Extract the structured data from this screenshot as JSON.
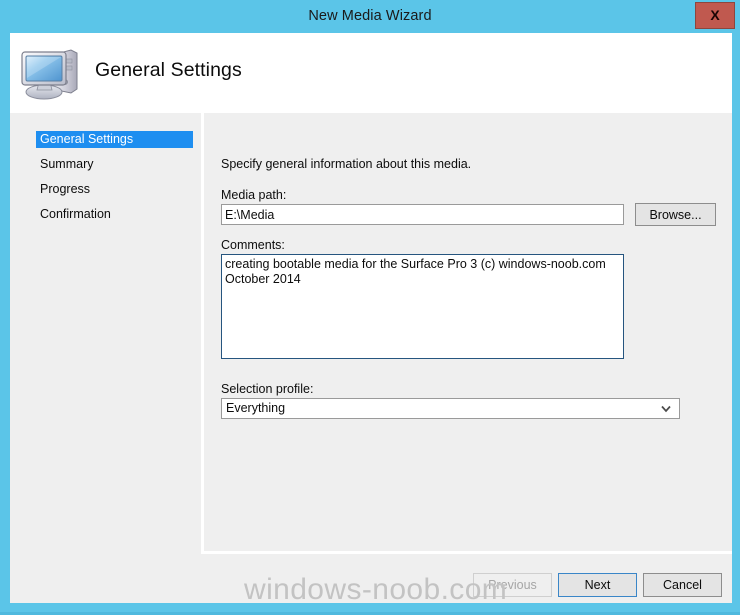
{
  "window": {
    "title": "New Media Wizard",
    "close_label": "X",
    "accent_color": "#5bc5e8",
    "close_color": "#c0594f"
  },
  "header": {
    "title": "General Settings",
    "icon": "computer-icon"
  },
  "sidebar": {
    "items": [
      {
        "label": "General Settings",
        "selected": true
      },
      {
        "label": "Summary",
        "selected": false
      },
      {
        "label": "Progress",
        "selected": false
      },
      {
        "label": "Confirmation",
        "selected": false
      }
    ],
    "selected_color": "#1e8ef0"
  },
  "main": {
    "intro": "Specify general information about this media.",
    "media_path": {
      "label": "Media path:",
      "value": "E:\\Media",
      "placeholder": "",
      "browse_label": "Browse..."
    },
    "comments": {
      "label": "Comments:",
      "value": "creating bootable media for the Surface Pro 3 (c) windows-noob.com October 2014",
      "placeholder": "",
      "focused": true
    },
    "selection_profile": {
      "label": "Selection profile:",
      "value": "Everything",
      "options": [
        "Everything"
      ],
      "arrow_icon": "chevron-down-icon"
    }
  },
  "footer": {
    "previous_label": "Previous",
    "previous_disabled": true,
    "next_label": "Next",
    "next_default": true,
    "cancel_label": "Cancel"
  },
  "watermark": {
    "text": "windows-noob.com"
  }
}
